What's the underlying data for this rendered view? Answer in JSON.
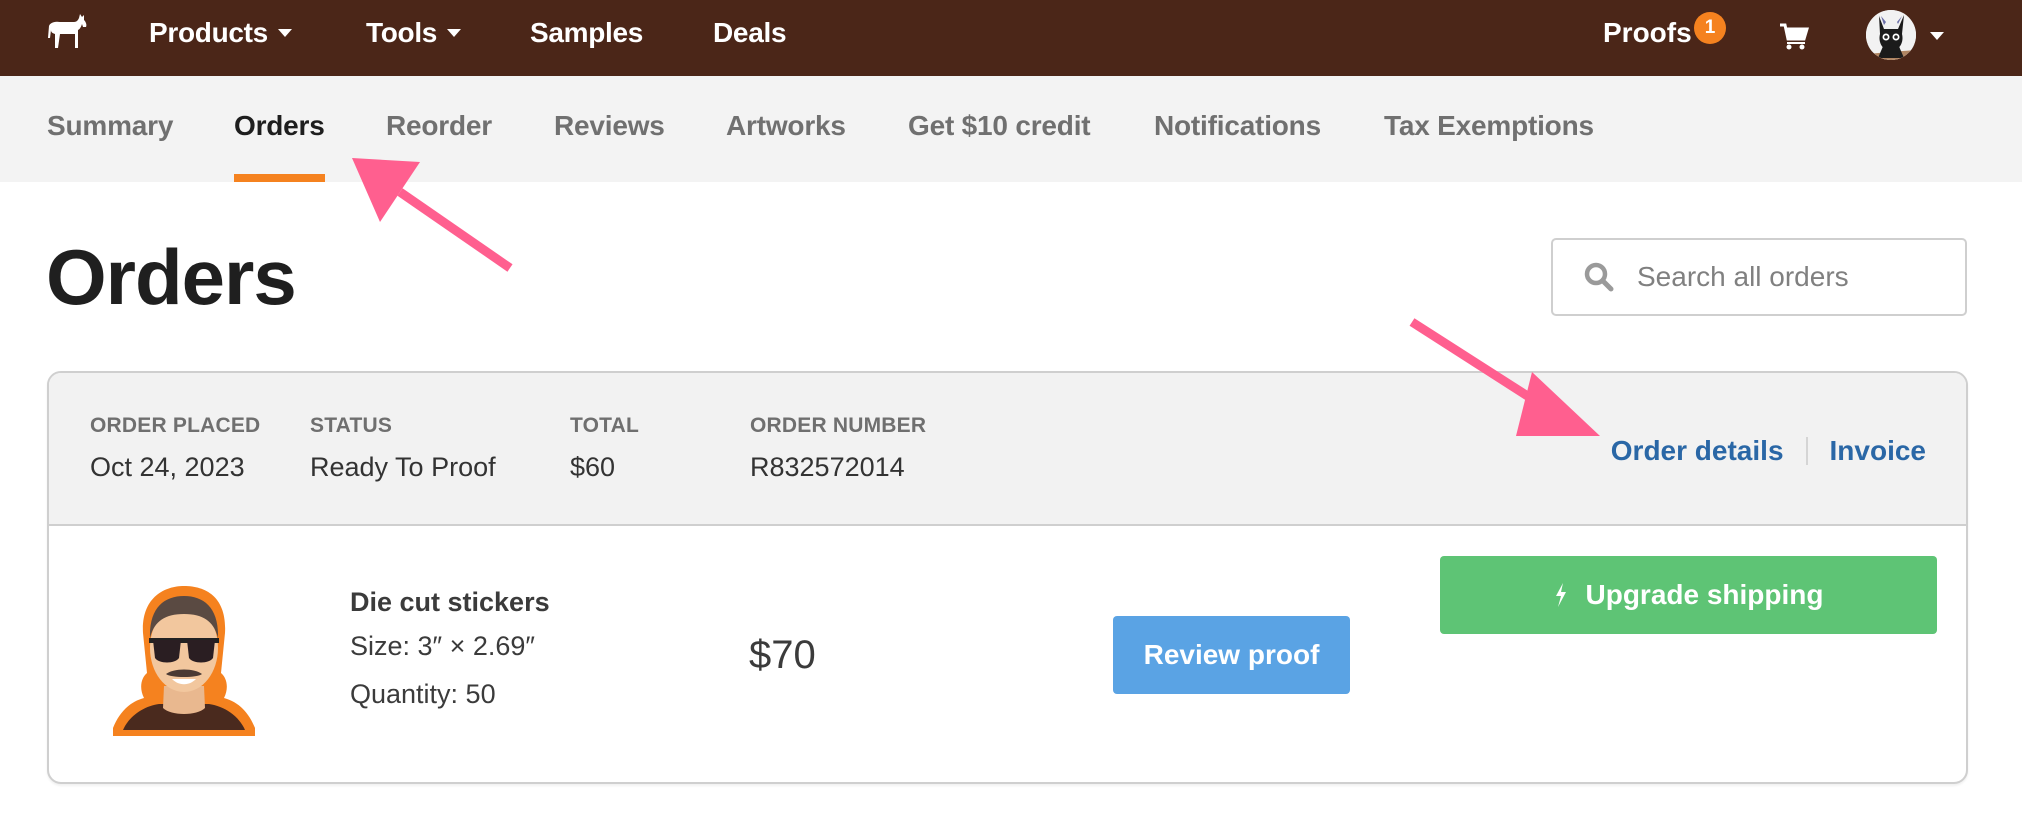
{
  "topnav": {
    "logo": "horse-logo",
    "items": [
      {
        "label": "Products",
        "has_dropdown": true
      },
      {
        "label": "Tools",
        "has_dropdown": true
      },
      {
        "label": "Samples",
        "has_dropdown": false
      },
      {
        "label": "Deals",
        "has_dropdown": false
      }
    ],
    "proofs": {
      "label": "Proofs",
      "badge_count": "1"
    },
    "cart_icon": "cart-icon",
    "avatar": "user-avatar-black-cat"
  },
  "subnav": {
    "tabs": [
      {
        "label": "Summary",
        "active": false
      },
      {
        "label": "Orders",
        "active": true
      },
      {
        "label": "Reorder",
        "active": false
      },
      {
        "label": "Reviews",
        "active": false
      },
      {
        "label": "Artworks",
        "active": false
      },
      {
        "label": "Get $10 credit",
        "active": false
      },
      {
        "label": "Notifications",
        "active": false
      },
      {
        "label": "Tax Exemptions",
        "active": false
      }
    ]
  },
  "page": {
    "title": "Orders",
    "search": {
      "placeholder": "Search all orders",
      "value": ""
    }
  },
  "order": {
    "header": {
      "placed_label": "ORDER PLACED",
      "placed_value": "Oct 24, 2023",
      "status_label": "STATUS",
      "status_value": "Ready To Proof",
      "total_label": "TOTAL",
      "total_value": "$60",
      "number_label": "ORDER NUMBER",
      "number_value": "R832572014",
      "details_link": "Order details",
      "invoice_link": "Invoice"
    },
    "item": {
      "name": "Die cut stickers",
      "size": "Size: 3″ × 2.69″",
      "quantity": "Quantity: 50",
      "price": "$70",
      "review_button": "Review proof",
      "upgrade_button": "Upgrade shipping"
    }
  },
  "colors": {
    "topbar": "#4b2618",
    "accent_orange": "#f5821f",
    "link_blue": "#2a67a6",
    "review_blue": "#5aa3e4",
    "upgrade_green": "#5ec475",
    "annotation_pink": "#ff5f8f"
  }
}
